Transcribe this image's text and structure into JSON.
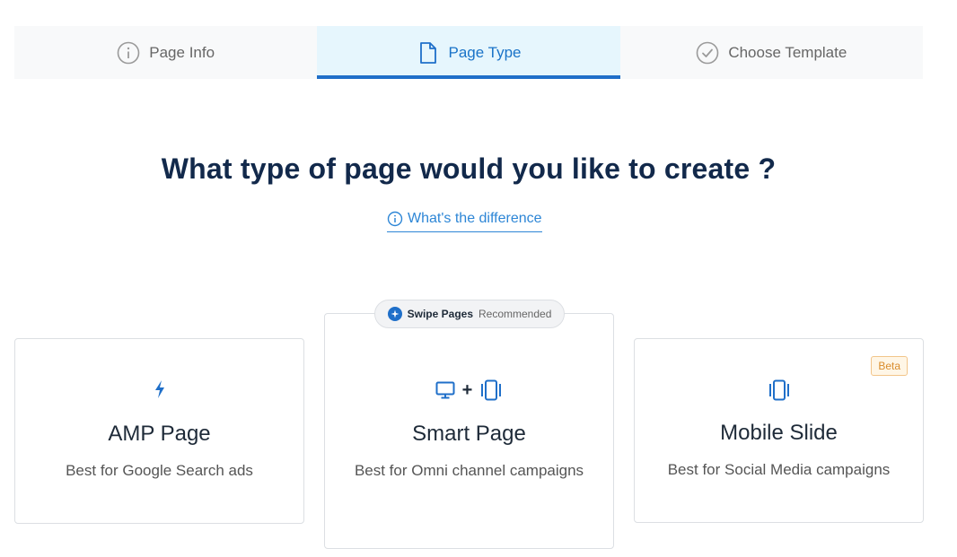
{
  "stepper": {
    "steps": [
      {
        "label": "Page Info",
        "icon": "info-circle-icon",
        "state": "inactive"
      },
      {
        "label": "Page Type",
        "icon": "document-icon",
        "state": "active"
      },
      {
        "label": "Choose Template",
        "icon": "check-circle-icon",
        "state": "inactive"
      }
    ]
  },
  "main": {
    "heading": "What type of page would you like to create ?",
    "difference_link": "What's the difference"
  },
  "cards": {
    "amp": {
      "title": "AMP Page",
      "description": "Best for Google Search ads",
      "icon": "lightning-icon"
    },
    "smart": {
      "title": "Smart Page",
      "description": "Best for Omni channel campaigns",
      "plus": "+",
      "badge_brand": "Swipe Pages",
      "badge_label": "Recommended",
      "icons": [
        "desktop-icon",
        "mobile-icon"
      ]
    },
    "mobile": {
      "title": "Mobile Slide",
      "description": "Best for Social Media campaigns",
      "badge": "Beta",
      "icon": "mobile-icon"
    }
  },
  "colors": {
    "accent": "#1f6fc9",
    "heading": "#12294b",
    "active_step_bg": "#e6f6fd",
    "beta": "#d98c2c"
  }
}
